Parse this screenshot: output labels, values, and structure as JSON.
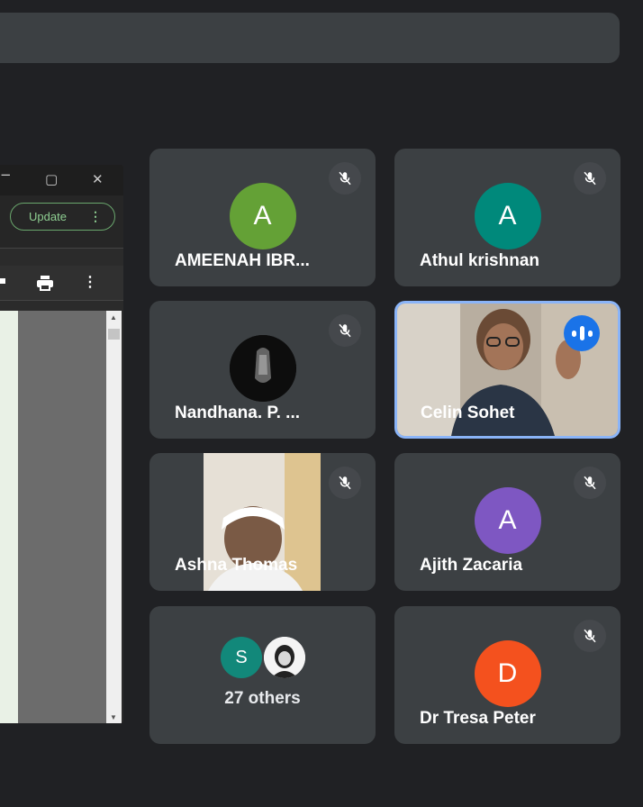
{
  "shared_window": {
    "update_label": "Update"
  },
  "participants": [
    {
      "name": "AMEENAH IBR...",
      "initial": "A",
      "color": "#64a136",
      "muted": true
    },
    {
      "name": "Athul krishnan",
      "initial": "A",
      "color": "#00897b",
      "muted": true
    },
    {
      "name": "Nandhana. P. ...",
      "muted": true
    },
    {
      "name": "Celin Sohet",
      "speaking": true
    },
    {
      "name": "Ashna Thomas",
      "muted": true
    },
    {
      "name": "Ajith Zacaria",
      "initial": "A",
      "color": "#7e57c2",
      "muted": true
    },
    {
      "others_label": "27 others",
      "initial": "S",
      "color": "#12887a"
    },
    {
      "name": "Dr Tresa Peter",
      "initial": "D",
      "color": "#f4511e",
      "muted": true
    }
  ]
}
